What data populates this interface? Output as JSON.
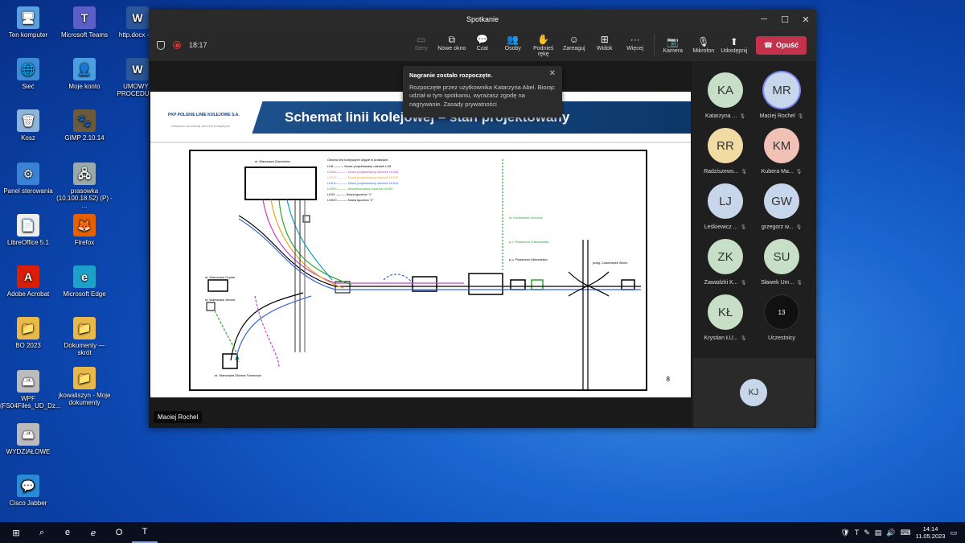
{
  "desktop": {
    "icons": [
      {
        "label": "Ten komputer",
        "icon": "computer-icon",
        "color": "#5aa0e0",
        "glyph": "🖥"
      },
      {
        "label": "Microsoft Teams",
        "icon": "teams-icon",
        "color": "#5b5fc7",
        "glyph": "T"
      },
      {
        "label": "http.docx - ...",
        "icon": "word-doc-icon",
        "color": "#2b579a",
        "glyph": "W"
      },
      {
        "label": "Sieć",
        "icon": "network-icon",
        "color": "#3d8ad6",
        "glyph": "🌐"
      },
      {
        "label": "Moje konto",
        "icon": "account-icon",
        "color": "#4a9fe0",
        "glyph": "👤"
      },
      {
        "label": "UMOWY I PROCEDURY",
        "icon": "word-doc-icon",
        "color": "#2b579a",
        "glyph": "W"
      },
      {
        "label": "Kosz",
        "icon": "recycle-bin-icon",
        "color": "#8fb4d9",
        "glyph": "🗑"
      },
      {
        "label": "GIMP 2.10.14",
        "icon": "gimp-icon",
        "color": "#6b5a3e",
        "glyph": "🐾"
      },
      {
        "label": "Panel sterowania",
        "icon": "control-panel-icon",
        "color": "#3b82d6",
        "glyph": "⚙"
      },
      {
        "label": "prasowka (10.100.18.52) (P) - ...",
        "icon": "network-drive-icon",
        "color": "#9aa",
        "glyph": "🖧"
      },
      {
        "label": "LibreOffice 5.1",
        "icon": "libreoffice-icon",
        "color": "#eee",
        "glyph": "📄"
      },
      {
        "label": "Firefox",
        "icon": "firefox-icon",
        "color": "#e66000",
        "glyph": "🦊"
      },
      {
        "label": "Adobe Acrobat",
        "icon": "acrobat-icon",
        "color": "#d81e05",
        "glyph": "A"
      },
      {
        "label": "Microsoft Edge",
        "icon": "edge-icon",
        "color": "#1da1c8",
        "glyph": "e"
      },
      {
        "label": "BO 2023",
        "icon": "folder-icon",
        "color": "#e8b94a",
        "glyph": "📁"
      },
      {
        "label": "Dokumenty — skrót",
        "icon": "folder-shortcut-icon",
        "color": "#e8b94a",
        "glyph": "📁"
      },
      {
        "label": "WPF (FS04Files_UD_Dz...",
        "icon": "drive-icon",
        "color": "#bbb",
        "glyph": "🖴"
      },
      {
        "label": "jkowaliszyn - Moje dokumenty",
        "icon": "folder-icon",
        "color": "#e8b94a",
        "glyph": "📁"
      },
      {
        "label": "WYDZIAŁOWE",
        "icon": "drive-icon",
        "color": "#bbb",
        "glyph": "🖴"
      },
      {
        "label": "Cisco Jabber",
        "icon": "jabber-icon",
        "color": "#2a8ad6",
        "glyph": "💬"
      }
    ]
  },
  "window": {
    "title": "Spotkanie",
    "timer": "18:17",
    "toolbar": [
      {
        "label": "Stery",
        "icon": "share-tray-icon",
        "glyph": "▭",
        "dim": true
      },
      {
        "label": "Nowe okno",
        "icon": "new-window-icon",
        "glyph": "⧉",
        "dim": false
      },
      {
        "label": "Czat",
        "icon": "chat-icon",
        "glyph": "💬",
        "dim": false
      },
      {
        "label": "Osoby",
        "icon": "people-icon",
        "glyph": "👥",
        "dim": false
      },
      {
        "label": "Podnieś rękę",
        "icon": "raise-hand-icon",
        "glyph": "✋",
        "dim": false
      },
      {
        "label": "Zareaguj",
        "icon": "react-icon",
        "glyph": "☺",
        "dim": false
      },
      {
        "label": "Widok",
        "icon": "view-icon",
        "glyph": "⊞",
        "dim": false
      },
      {
        "label": "Więcej",
        "icon": "more-icon",
        "glyph": "···",
        "dim": false
      }
    ],
    "media": [
      {
        "label": "Kamera",
        "icon": "camera-off-icon",
        "glyph": "📷"
      },
      {
        "label": "Mikrofon",
        "icon": "mic-off-icon",
        "glyph": "🎙"
      },
      {
        "label": "Udostępnij",
        "icon": "share-icon",
        "glyph": "⬆"
      }
    ],
    "leave_label": "Opuść"
  },
  "notification": {
    "title": "Nagranie zostało rozpoczęte.",
    "body": "Rozpoczęte przez użytkownika Katarzyna Abel. Biorąc udział w tym spotkaniu, wyrażasz zgodę na nagrywanie. Zasady prywatności"
  },
  "slide": {
    "title": "Schemat linii kolejowej – stan projektowany",
    "logo": "PKP POLSKIE LINIE KOLEJOWE S.A.",
    "logo_sub": "Zarządca narodowej sieci linii kolejowych",
    "page": "8",
    "speaker": "Maciej Rochel"
  },
  "participants": [
    {
      "initials": "KA",
      "name": "Katarzyna ...",
      "bg": "#c7dfc7",
      "active": false
    },
    {
      "initials": "MR",
      "name": "Maciej Rochel",
      "bg": "#c8d6ec",
      "active": true
    },
    {
      "initials": "RR",
      "name": "Radziszews...",
      "bg": "#f1dba2",
      "active": false
    },
    {
      "initials": "KM",
      "name": "Kubera Ma...",
      "bg": "#f2c1b6",
      "active": false
    },
    {
      "initials": "LJ",
      "name": "Leśkiewicz ...",
      "bg": "#c8d6ec",
      "active": false
    },
    {
      "initials": "GW",
      "name": "grzegorz w...",
      "bg": "#c8d6ec",
      "active": false
    },
    {
      "initials": "ZK",
      "name": "Zawadzki K...",
      "bg": "#c7dfc7",
      "active": false
    },
    {
      "initials": "SU",
      "name": "Sławek Um...",
      "bg": "#c7dfc7",
      "active": false
    },
    {
      "initials": "KŁ",
      "name": "Krystian ŁU...",
      "bg": "#c7dfc7",
      "active": false
    },
    {
      "initials": "13",
      "name": "Uczestnicy",
      "bg": "#111111",
      "active": false
    }
  ],
  "self_tile": {
    "initials": "KJ"
  },
  "taskbar": {
    "apps": [
      {
        "icon": "windows-start-icon",
        "glyph": "⊞"
      },
      {
        "icon": "search-icon",
        "glyph": "⌕"
      },
      {
        "icon": "edge-icon",
        "glyph": "e"
      },
      {
        "icon": "ie-icon",
        "glyph": "ℯ"
      },
      {
        "icon": "outlook-icon",
        "glyph": "O"
      },
      {
        "icon": "teams-icon",
        "glyph": "T"
      }
    ],
    "time": "14:14",
    "date": "11.05.2023"
  }
}
